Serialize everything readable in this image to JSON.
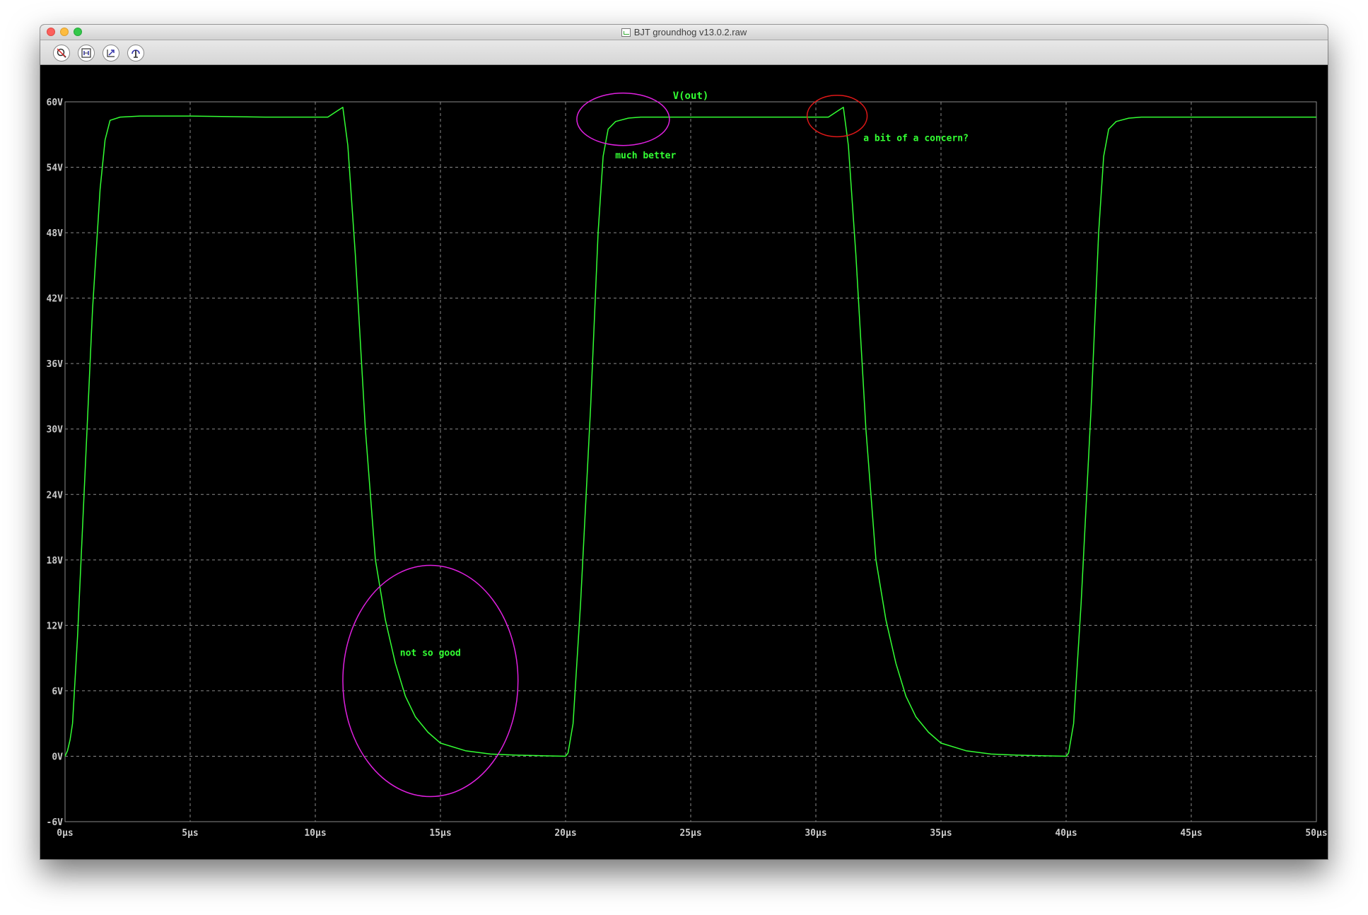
{
  "window": {
    "title": "BJT groundhog v13.0.2.raw"
  },
  "toolbar": {
    "buttons": [
      {
        "name": "zoom-out-button",
        "icon": "zoom-out-icon"
      },
      {
        "name": "zoom-full-extents-button",
        "icon": "zoom-extents-icon"
      },
      {
        "name": "zoom-back-button",
        "icon": "zoom-back-icon"
      },
      {
        "name": "autorange-button",
        "icon": "autorange-icon"
      }
    ]
  },
  "colors": {
    "trace": "#33ff33",
    "grid": "#8a8a8a",
    "label": "#c9c9c9",
    "magenta_marker": "#e020e0",
    "red_marker": "#e01818"
  },
  "chart_data": {
    "type": "line",
    "title": "V(out)",
    "xlabel": "",
    "ylabel": "",
    "xlim": [
      0,
      50
    ],
    "ylim": [
      -6,
      60
    ],
    "x_unit": "µs",
    "y_unit": "V",
    "x_ticks": [
      "0µs",
      "5µs",
      "10µs",
      "15µs",
      "20µs",
      "25µs",
      "30µs",
      "35µs",
      "40µs",
      "45µs",
      "50µs"
    ],
    "y_ticks": [
      "-6V",
      "0V",
      "6V",
      "12V",
      "18V",
      "24V",
      "30V",
      "36V",
      "42V",
      "48V",
      "54V",
      "60V"
    ],
    "grid": true,
    "series": [
      {
        "name": "V(out)",
        "x": [
          0,
          0.1,
          0.2,
          0.3,
          0.5,
          0.8,
          1.1,
          1.4,
          1.6,
          1.8,
          2.2,
          3,
          5,
          8,
          10,
          10.5,
          10.9,
          11.1,
          11.3,
          11.6,
          12,
          12.4,
          12.8,
          13.2,
          13.6,
          14,
          14.5,
          15,
          16,
          17,
          18,
          19,
          20,
          20.1,
          20.3,
          20.6,
          21,
          21.3,
          21.5,
          21.7,
          22,
          22.5,
          23,
          25,
          28,
          30,
          30.5,
          30.9,
          31.1,
          31.3,
          31.6,
          32,
          32.4,
          32.8,
          33.2,
          33.6,
          34,
          34.5,
          35,
          36,
          37,
          38,
          39,
          40,
          40.1,
          40.3,
          40.6,
          41,
          41.3,
          41.5,
          41.7,
          42,
          42.5,
          43,
          45,
          48,
          50
        ],
        "y": [
          0,
          0.5,
          1.5,
          3,
          11,
          26,
          41,
          52,
          56.5,
          58.3,
          58.6,
          58.7,
          58.7,
          58.6,
          58.6,
          58.6,
          59.2,
          59.5,
          56,
          46,
          30,
          18,
          12.5,
          8.5,
          5.5,
          3.6,
          2.2,
          1.2,
          0.5,
          0.2,
          0.1,
          0.05,
          0,
          0.3,
          3,
          14,
          32,
          48,
          55,
          57.5,
          58.2,
          58.5,
          58.6,
          58.6,
          58.6,
          58.6,
          58.6,
          59.2,
          59.5,
          56,
          46,
          30,
          18,
          12.5,
          8.5,
          5.5,
          3.6,
          2.2,
          1.2,
          0.5,
          0.2,
          0.1,
          0.05,
          0,
          0.3,
          3,
          14,
          32,
          48,
          55,
          57.5,
          58.2,
          58.5,
          58.6,
          58.6,
          58.6,
          58.6
        ]
      }
    ],
    "annotations": [
      {
        "text": "not so good",
        "x": 14.6,
        "y": 9.2,
        "marker": {
          "shape": "ellipse",
          "cx": 14.6,
          "cy": 6.9,
          "rx": 3.5,
          "ry": 10.6,
          "color": "magenta"
        }
      },
      {
        "text": "much better",
        "x": 23.2,
        "y": 54.8,
        "marker": {
          "shape": "ellipse",
          "cx": 22.3,
          "cy": 58.4,
          "rx": 1.85,
          "ry": 2.4,
          "color": "magenta"
        }
      },
      {
        "text": "a bit of a concern?",
        "x": 34,
        "y": 56.4,
        "marker": {
          "shape": "ellipse",
          "cx": 30.85,
          "cy": 58.7,
          "rx": 1.2,
          "ry": 1.9,
          "color": "red"
        }
      }
    ]
  }
}
